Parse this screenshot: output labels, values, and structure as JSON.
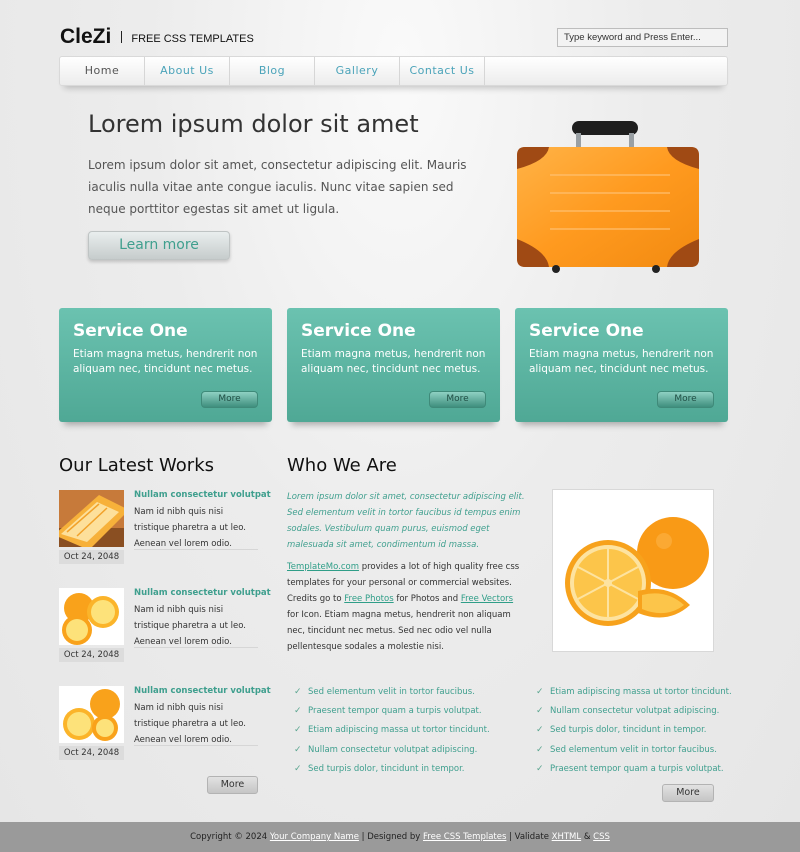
{
  "header": {
    "logo_name": "CleZi",
    "tagline": "FREE CSS TEMPLATES",
    "search_value": "Type keyword and Press Enter..."
  },
  "nav": {
    "items": [
      {
        "label": "Home"
      },
      {
        "label": "About Us"
      },
      {
        "label": "Blog"
      },
      {
        "label": "Gallery"
      },
      {
        "label": "Contact Us"
      }
    ]
  },
  "hero": {
    "title": "Lorem ipsum dolor sit amet",
    "text": "Lorem ipsum dolor sit amet, consectetur adipiscing elit. Mauris iaculis nulla vitae ante congue iaculis. Nunc vitae sapien sed neque porttitor egestas sit amet ut ligula.",
    "button_label": "Learn more"
  },
  "services": [
    {
      "title": "Service One",
      "text": "Etiam magna metus, hendrerit non aliquam nec, tincidunt nec metus.",
      "more": "More"
    },
    {
      "title": "Service One",
      "text": "Etiam magna metus, hendrerit non aliquam nec, tincidunt nec metus.",
      "more": "More"
    },
    {
      "title": "Service One",
      "text": "Etiam magna metus, hendrerit non aliquam nec, tincidunt nec metus.",
      "more": "More"
    }
  ],
  "works": {
    "title": "Our Latest Works",
    "items": [
      {
        "title": "Nullam consectetur volutpat",
        "text": "Nam id nibh quis nisi tristique pharetra a ut leo. Aenean vel lorem odio.",
        "date": "Oct 24, 2048"
      },
      {
        "title": "Nullam consectetur volutpat",
        "text": "Nam id nibh quis nisi tristique pharetra a ut leo. Aenean vel lorem odio.",
        "date": "Oct 24, 2048"
      },
      {
        "title": "Nullam consectetur volutpat",
        "text": "Nam id nibh quis nisi tristique pharetra a ut leo. Aenean vel lorem odio.",
        "date": "Oct 24, 2048"
      }
    ],
    "more": "More"
  },
  "who": {
    "title": "Who We Are",
    "italic": "Lorem ipsum dolor sit amet, consectetur adipiscing elit. Sed elementum velit in tortor faucibus id tempus enim sodales. Vestibulum quam purus, euismod eget malesuada sit amet, condimentum id massa.",
    "link_templatemo": "TemplateMo.com",
    "body_1": " provides a lot of high quality free css templates for your personal or commercial websites. Credits go to ",
    "link_free_photos": "Free Photos",
    "body_2": " for Photos and ",
    "link_free_vectors": "Free Vectors",
    "body_3": " for Icon. Etiam magna metus, hendrerit non aliquam nec, tincidunt nec metus. Sed nec odio vel nulla pellentesque sodales a molestie nisi.",
    "bullets_left": [
      "Sed elementum velit in tortor faucibus.",
      "Praesent tempor quam a turpis volutpat.",
      "Etiam adipiscing massa ut tortor tincidunt.",
      "Nullam consectetur volutpat adipiscing.",
      "Sed turpis dolor, tincidunt in tempor."
    ],
    "bullets_right": [
      "Etiam adipiscing massa ut tortor tincidunt.",
      "Nullam consectetur volutpat adipiscing.",
      "Sed turpis dolor, tincidunt in tempor.",
      "Sed elementum velit in tortor faucibus.",
      "Praesent tempor quam a turpis volutpat."
    ],
    "more": "More"
  },
  "footer": {
    "copyright": "Copyright © 2024 ",
    "company_link": "Your Company Name",
    "designed_by": " | Designed by ",
    "templates_link": "Free CSS Templates",
    "validate": " | Validate ",
    "xhtml_link": "XHTML",
    "amp": " & ",
    "css_link": "CSS"
  },
  "colors": {
    "accent": "#3f9f8e",
    "nav_link": "#4aa3b9",
    "service_box": "#5db5a2",
    "footer_bg": "#9a9a9a"
  }
}
